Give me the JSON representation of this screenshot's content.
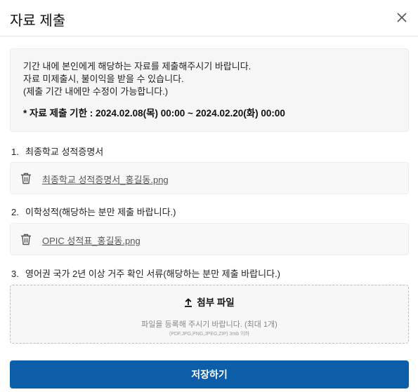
{
  "dialog": {
    "title": "자료 제출",
    "close_icon": "close-icon"
  },
  "notice": {
    "line1": "기간 내에 본인에게 해당하는 자료를 제출해주시기 바랍니다.",
    "line2": "자료 미제출시, 불이익을 받을 수 있습니다.",
    "line3": "(제출 기간 내에만 수정이 가능합니다.)",
    "deadline": "* 자료 제출 기한 : 2024.02.08(목) 00:00 ~ 2024.02.20(화) 00:00"
  },
  "sections": [
    {
      "number": "1.",
      "title": "최종학교 성적증명서",
      "file": "최종학교 성적증명서_홍길동.png"
    },
    {
      "number": "2.",
      "title": "이학성적(해당하는 분만 제출 바랍니다.)",
      "file": "OPIC 성적표_홍길동.png"
    },
    {
      "number": "3.",
      "title": "영어권 국가 2년 이상 거주 확인 서류(해당하는 분만 제출 바랍니다.)"
    }
  ],
  "upload": {
    "button_label": "첨부 파일",
    "hint": "파일을 등록해 주시기 바랍니다. (최대 1개)",
    "sub_hint": "(PDF,JPG,PNG,JPEG,ZIP) 3mb 이하",
    "icon": "upload-icon"
  },
  "save_button": "저장하기",
  "colors": {
    "primary": "#0d5ea8",
    "notice_bg": "#f6f6f6",
    "file_bg": "#f8f8f8"
  }
}
